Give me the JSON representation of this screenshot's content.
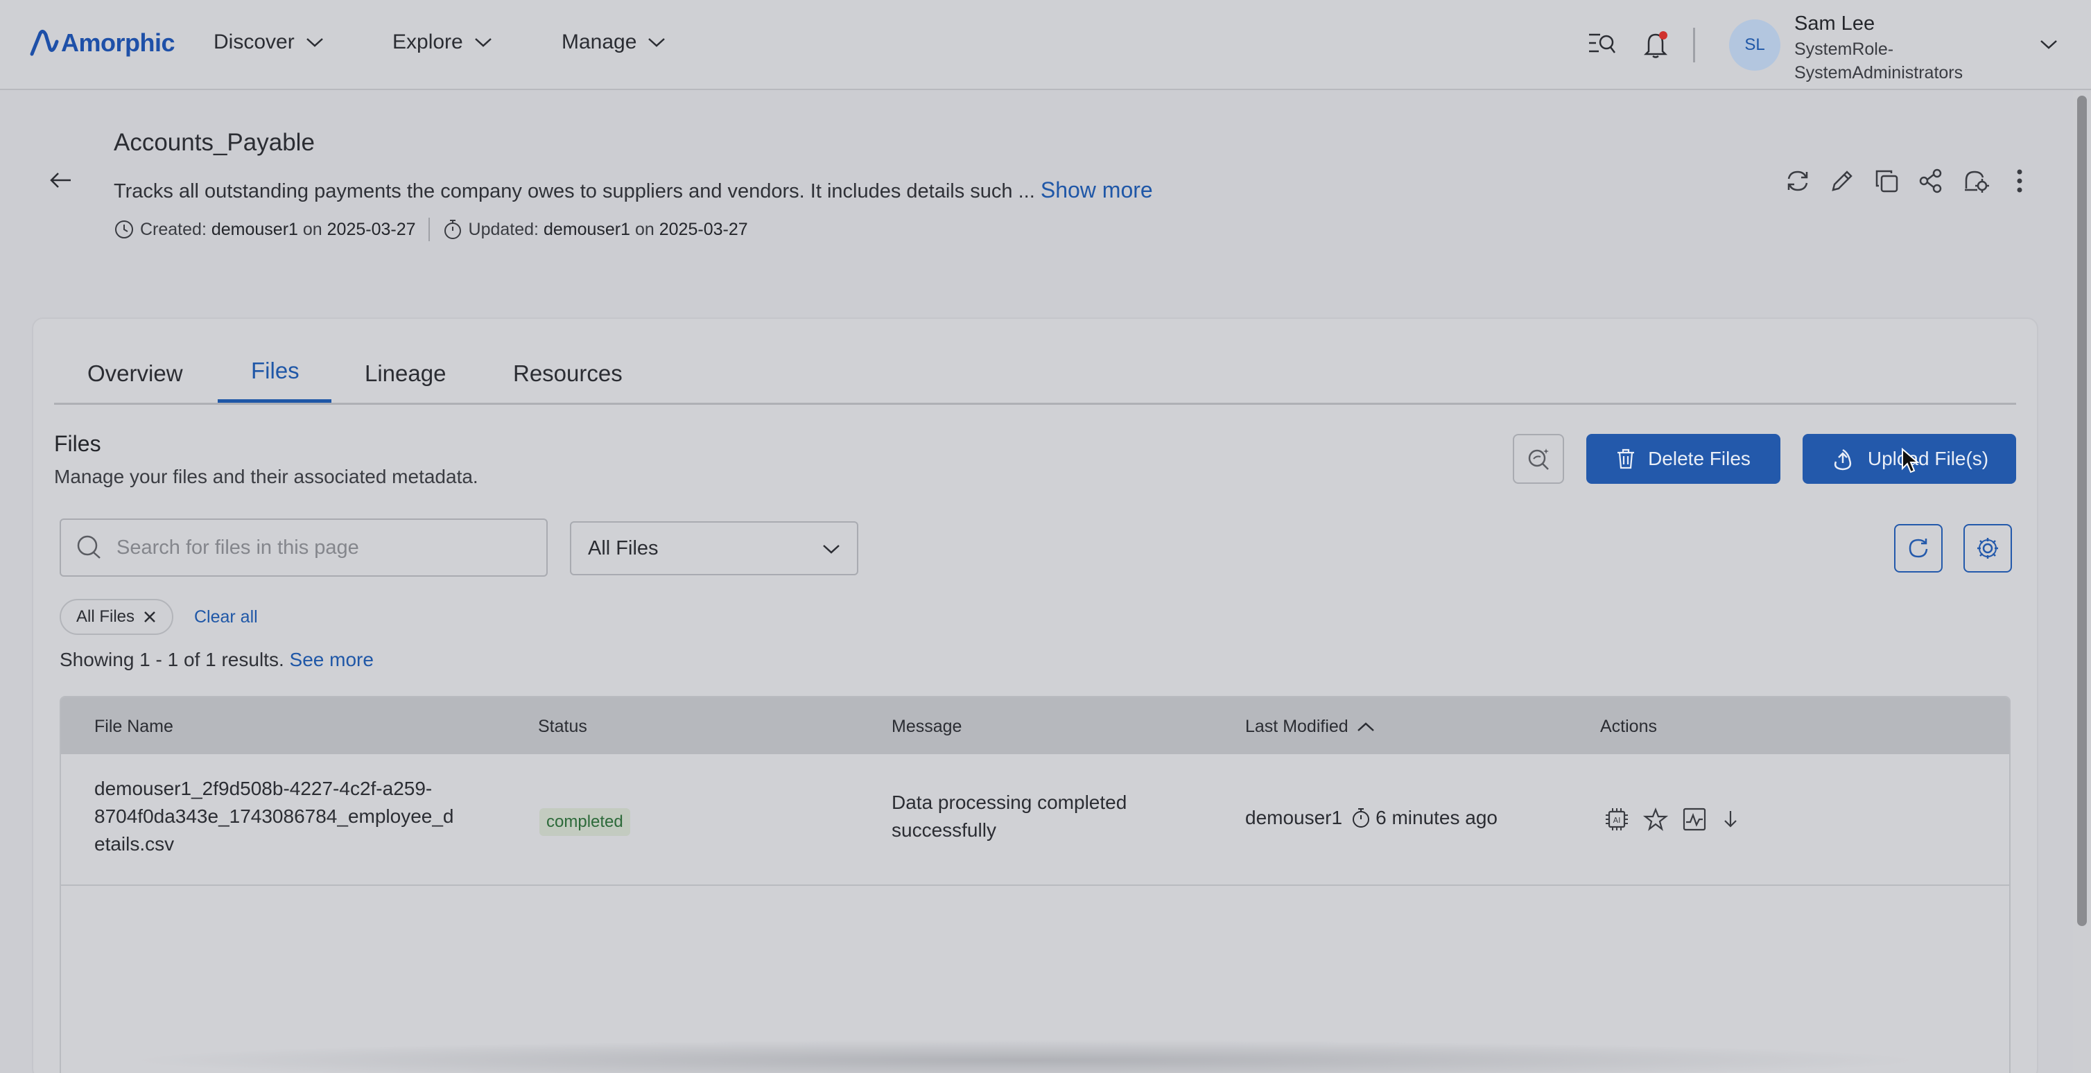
{
  "app": {
    "logo_text": "Amorphic",
    "brand_color": "#1f57a7"
  },
  "nav": {
    "items": [
      {
        "label": "Discover"
      },
      {
        "label": "Explore"
      },
      {
        "label": "Manage"
      }
    ]
  },
  "topbar_icons": [
    "search-list-icon",
    "bell-icon"
  ],
  "user": {
    "initials": "SL",
    "name": "Sam Lee",
    "role_line1": "SystemRole-",
    "role_line2": "SystemAdministrators"
  },
  "dataset": {
    "title": "Accounts_Payable",
    "description": "Tracks all outstanding payments the company owes to suppliers and vendors. It includes details such ... ",
    "show_more": "Show more",
    "created_label": "Created:",
    "created_by": "demouser1",
    "created_on_word": "on",
    "created_date": "2025-03-27",
    "updated_label": "Updated:",
    "updated_by": "demouser1",
    "updated_on_word": "on",
    "updated_date": "2025-03-27"
  },
  "title_actions": [
    "refresh-icon",
    "edit-icon",
    "copy-icon",
    "share-icon",
    "settings-bell-icon",
    "more-vertical-icon"
  ],
  "tabs": [
    {
      "label": "Overview"
    },
    {
      "label": "Files",
      "active": true
    },
    {
      "label": "Lineage"
    },
    {
      "label": "Resources"
    }
  ],
  "files": {
    "title": "Files",
    "subtitle": "Manage your files and their associated metadata.",
    "delete_label": "Delete Files",
    "upload_label": "Upload File(s)",
    "search_placeholder": "Search for files in this page",
    "filter_selected": "All Files",
    "chip_label": "All Files",
    "clear_all": "Clear all",
    "showing": "Showing 1 - 1 of 1 results.",
    "see_more": "See more"
  },
  "table": {
    "columns": [
      "File Name",
      "Status",
      "Message",
      "Last Modified",
      "Actions"
    ],
    "rows": [
      {
        "file_name_l1": "demouser1_2f9d508b-4227-4c2f-a259-",
        "file_name_l2": "8704f0da343e_1743086784_employee_d",
        "file_name_l3": "etails.csv",
        "status": "completed",
        "message_l1": "Data processing completed",
        "message_l2": "successfully",
        "modified_by": "demouser1",
        "modified_ago": "6 minutes ago",
        "actions": [
          "ai-chip-icon",
          "star-icon",
          "chart-icon",
          "download-icon"
        ]
      }
    ]
  }
}
